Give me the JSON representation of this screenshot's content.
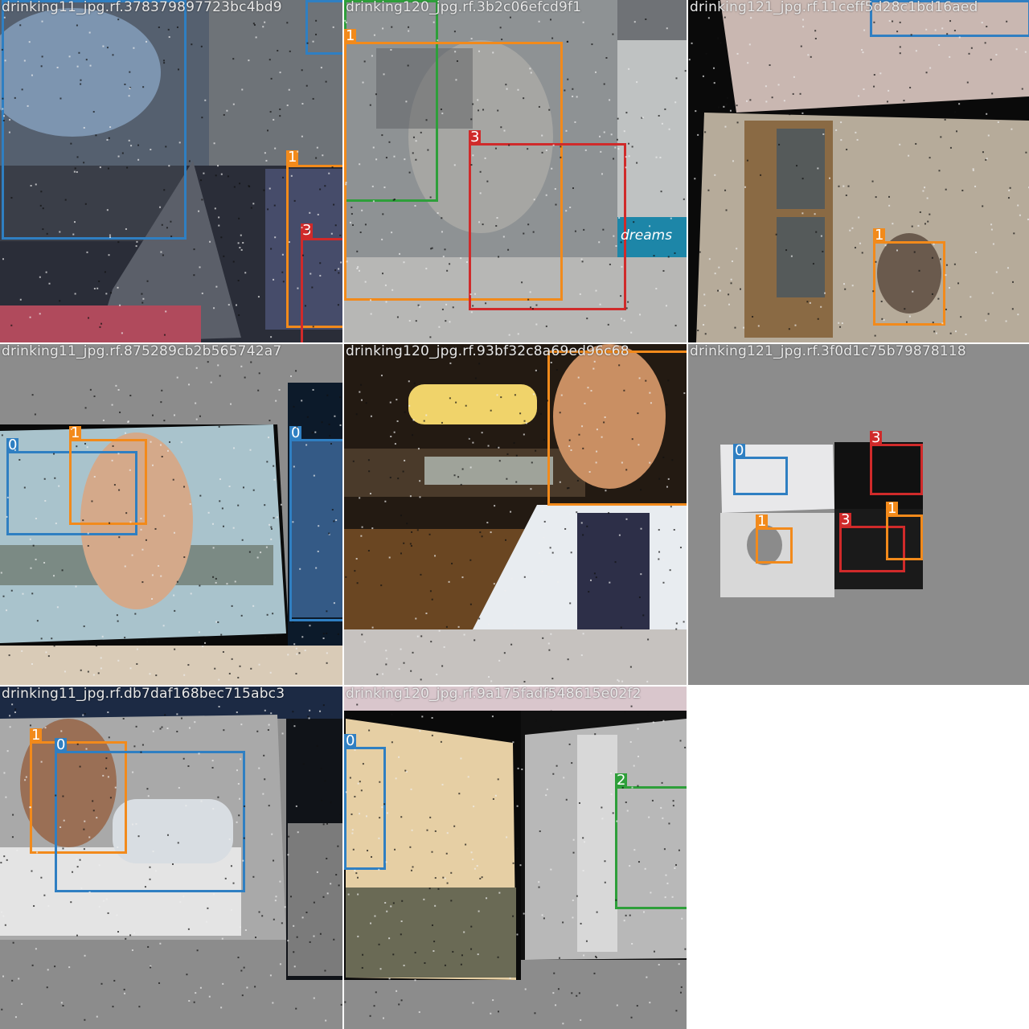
{
  "grid": {
    "tiles": [
      {
        "filename": "drinking11_jpg.rf.378379897723bc4bd9",
        "labels": [
          "1",
          "3"
        ]
      },
      {
        "filename": "drinking120_jpg.rf.3b2c06efcd9f1",
        "labels": [
          "1",
          "3"
        ],
        "sign_text": "dreams"
      },
      {
        "filename": "drinking121_jpg.rf.11ceff5d28c1bd16aed",
        "labels": [
          "1"
        ]
      },
      {
        "filename": "drinking11_jpg.rf.875289cb2b565742a7",
        "labels": [
          "0",
          "1",
          "0"
        ]
      },
      {
        "filename": "drinking120_jpg.rf.93bf32c8a69ed96c68",
        "labels": [
          "1"
        ]
      },
      {
        "filename": "drinking121_jpg.rf.3f0d1c75b79878118",
        "labels": [
          "0",
          "3",
          "1",
          "3",
          "1"
        ]
      },
      {
        "filename": "drinking11_jpg.rf.db7daf168bec715abc3",
        "labels": [
          "1",
          "0"
        ]
      },
      {
        "filename": "drinking120_jpg.rf.9a175fadf548615e02f2",
        "labels": [
          "0",
          "2"
        ]
      }
    ]
  },
  "class_colors": {
    "0": "#2f7fc2",
    "1": "#f28a1b",
    "2": "#2e9f3a",
    "3": "#d02a2a"
  }
}
